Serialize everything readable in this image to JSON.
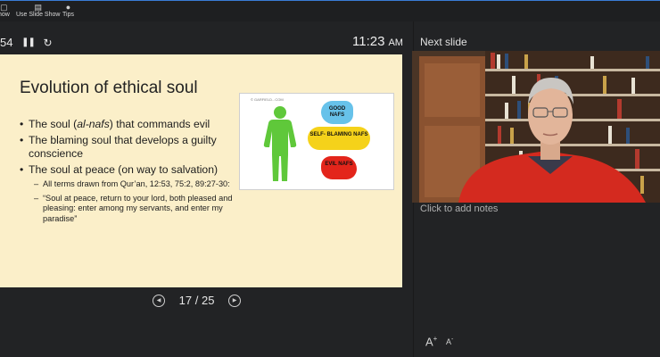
{
  "toolbar": {
    "items": [
      {
        "label": "how",
        "icon": "monitor-icon"
      },
      {
        "label": "Use Slide Show",
        "icon": "display-icon"
      },
      {
        "label": "Tips",
        "icon": "info-icon"
      }
    ]
  },
  "presenter": {
    "timer": "54",
    "clock": "11:23",
    "ampm": "AM",
    "next_slide_label": "Next slide",
    "notes_placeholder": "Click to add notes",
    "font_increase": "A",
    "font_decrease": "A",
    "font_increase_sup": "+",
    "font_decrease_sup": "-"
  },
  "slide": {
    "title": "Evolution of ethical soul",
    "bullets": [
      {
        "prefix": "The soul (",
        "italic": "al-nafs",
        "suffix": ") that commands evil"
      },
      {
        "text": "The blaming soul that develops a guilty conscience"
      },
      {
        "text": "The soul at peace (on way to salvation)"
      }
    ],
    "sub_bullets": [
      "All terms drawn from Qur’an, 12:53, 75:2, 89:27-30:",
      "“Soul at peace, return to your lord, both pleased and pleasing: enter among my servants, and enter my paradise”"
    ],
    "illustration": {
      "credit": "© GARFIELD...COM",
      "good": "GOOD NAFS",
      "blaming": "SELF- BLAMING NAFS",
      "evil": "EVIL NAFS",
      "colors": {
        "figure": "#5fc83a",
        "good": "#67c2ea",
        "blaming": "#f5d21a",
        "evil": "#e3251b"
      }
    }
  },
  "navigation": {
    "current": "17",
    "total": "25",
    "separator": "/"
  },
  "colors": {
    "background": "#222325",
    "slide_background": "#fbefc9",
    "accent_border": "#3a7bd5"
  }
}
